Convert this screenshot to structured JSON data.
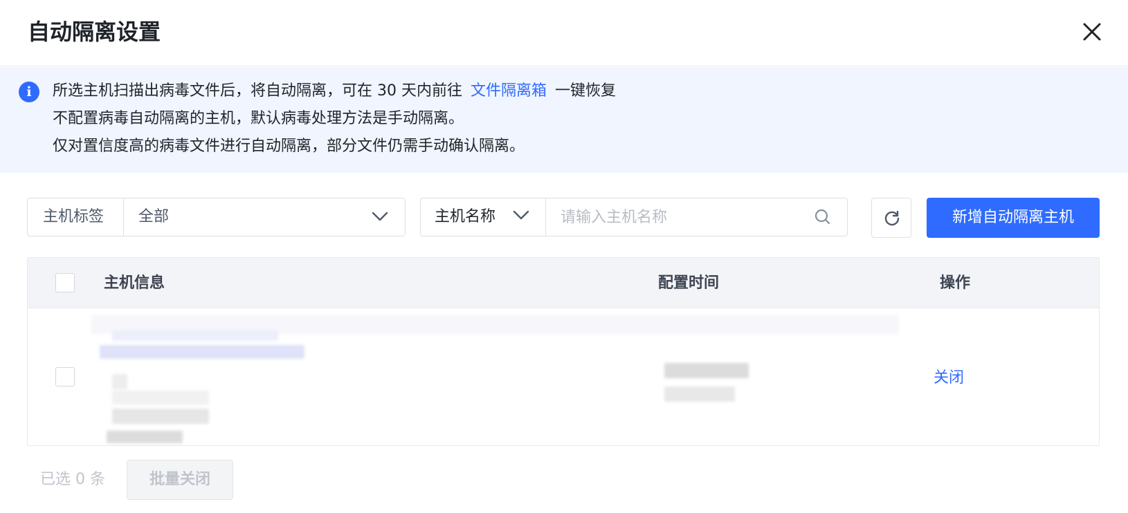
{
  "dialog": {
    "title": "自动隔离设置"
  },
  "notice": {
    "line1_before": "所选主机扫描出病毒文件后，将自动隔离，可在 30 天内前往",
    "line1_link": "文件隔离箱",
    "line1_after": "一键恢复",
    "line2": "不配置病毒自动隔离的主机，默认病毒处理方法是手动隔离。",
    "line3": "仅对置信度高的病毒文件进行自动隔离，部分文件仍需手动确认隔离。"
  },
  "filters": {
    "tag_label": "主机标签",
    "tag_value": "全部",
    "search_type": "主机名称",
    "search_placeholder": "请输入主机名称",
    "add_button": "新增自动隔离主机"
  },
  "table": {
    "columns": [
      "主机信息",
      "配置时间",
      "操作"
    ],
    "rows": [
      {
        "action": "关闭"
      }
    ]
  },
  "footer": {
    "selected": "已选 0 条",
    "batch_button": "批量关闭"
  },
  "colors": {
    "primary": "#2f6bff",
    "notice_bg": "#f0f5ff"
  }
}
